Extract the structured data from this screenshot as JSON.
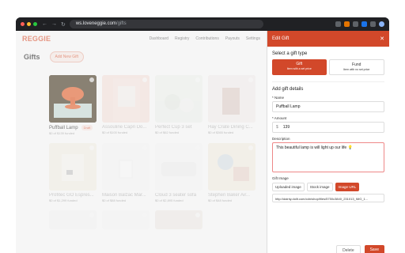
{
  "browser": {
    "url_host": "ws.loveneggie.com",
    "url_path": "/gifts"
  },
  "app": {
    "logo": "REGGIE",
    "nav": [
      "Dashboard",
      "Registry",
      "Contributions",
      "Payouts",
      "Settings"
    ],
    "page_title": "Gifts",
    "add_button": "Add New Gift"
  },
  "gifts": [
    {
      "name": "Puffball Lamp",
      "sub": "$0 of $139 funded",
      "badge": "Draft"
    },
    {
      "name": "Assouline Capri Do...",
      "sub": "$0 of $100 funded"
    },
    {
      "name": "Perfect Cup 3 set",
      "sub": "$0 of $62 funded"
    },
    {
      "name": "Hay Crate Dining C...",
      "sub": "$0 of $365 funded"
    },
    {
      "name": "Profitec GO Espres...",
      "sub": "$0 of $1,299 funded"
    },
    {
      "name": "Maison Balzac Mar...",
      "sub": "$0 of $88 funded"
    },
    {
      "name": "Cloud 3 seater sofa",
      "sub": "$0 of $2,895 funded"
    },
    {
      "name": "Stephen Baker Air...",
      "sub": "$0 of $48 funded"
    }
  ],
  "panel": {
    "title": "Edit Gift",
    "select_type": "Select a gift type",
    "types": [
      {
        "label": "Gift",
        "sub": "Item with a set price"
      },
      {
        "label": "Fund",
        "sub": "Item with no set price"
      }
    ],
    "details_title": "Add gift details",
    "name_label": "* Name",
    "name_value": "Puffball Lamp",
    "amount_label": "* Amount",
    "currency": "$",
    "amount_value": "139",
    "description_label": "Description",
    "description_value": "This beautiful lamp is will light up our life 💡",
    "image_label": "Gift Image",
    "image_tabs": [
      "Uploaded image",
      "Stock image",
      "Image URL"
    ],
    "image_url": "http://dainty.dollt.com/cdn/shop/files/5750c3840_231013_IMG_1...",
    "delete_label": "Delete",
    "save_label": "Save"
  }
}
